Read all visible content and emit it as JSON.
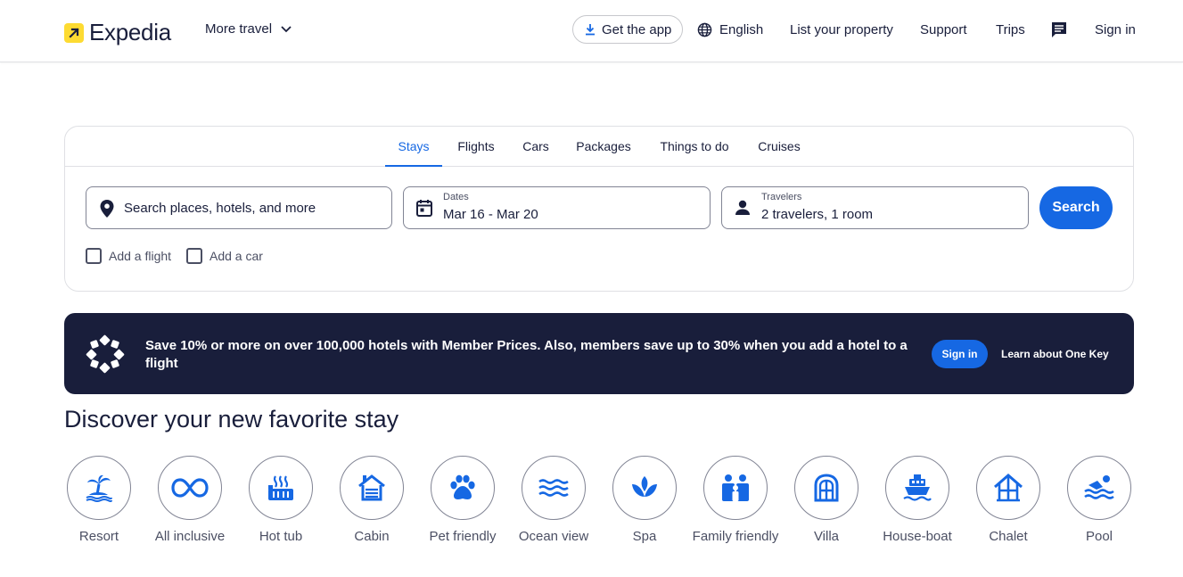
{
  "header": {
    "logo_text": "Expedia",
    "more_travel": "More travel",
    "get_app": "Get the app",
    "language": "English",
    "list_property": "List your property",
    "support": "Support",
    "trips": "Trips",
    "sign_in": "Sign in"
  },
  "search": {
    "tabs": [
      "Stays",
      "Flights",
      "Cars",
      "Packages",
      "Things to do",
      "Cruises"
    ],
    "active_tab": "Stays",
    "destination_placeholder": "Search places, hotels, and more",
    "dates_label": "Dates",
    "dates_value": "Mar 16 - Mar 20",
    "travelers_label": "Travelers",
    "travelers_value": "2 travelers, 1 room",
    "search_button": "Search",
    "add_flight": "Add a flight",
    "add_car": "Add a car"
  },
  "banner": {
    "text": "Save 10% or more on over 100,000 hotels with Member Prices. Also, members save up to 30% when you add a hotel to a flight",
    "sign_in": "Sign in",
    "learn_more": "Learn about One Key"
  },
  "discover": {
    "title": "Discover your new favorite stay",
    "categories": [
      {
        "label": "Resort",
        "icon": "palm-tree-icon"
      },
      {
        "label": "All inclusive",
        "icon": "infinity-icon"
      },
      {
        "label": "Hot tub",
        "icon": "hot-tub-icon"
      },
      {
        "label": "Cabin",
        "icon": "cabin-icon"
      },
      {
        "label": "Pet friendly",
        "icon": "paw-icon"
      },
      {
        "label": "Ocean view",
        "icon": "waves-icon"
      },
      {
        "label": "Spa",
        "icon": "lotus-icon"
      },
      {
        "label": "Family friendly",
        "icon": "family-icon"
      },
      {
        "label": "Villa",
        "icon": "villa-icon"
      },
      {
        "label": "House-boat",
        "icon": "houseboat-icon"
      },
      {
        "label": "Chalet",
        "icon": "chalet-icon"
      },
      {
        "label": "Pool",
        "icon": "swimmer-icon"
      }
    ]
  },
  "colors": {
    "brand_blue": "#1668e3",
    "navy": "#191e3b",
    "logo_yellow": "#fddb32"
  }
}
